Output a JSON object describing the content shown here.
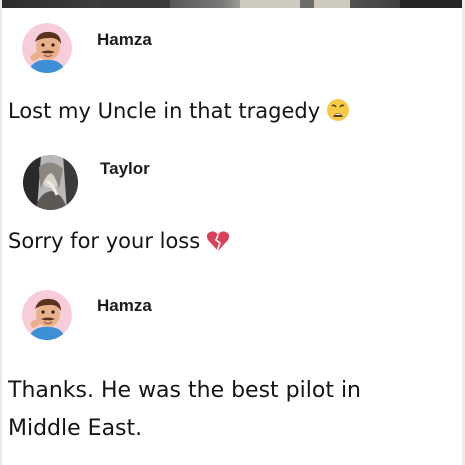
{
  "thread": {
    "comments": [
      {
        "author": "Hamza",
        "text": "Lost my Uncle in that tragedy",
        "emoji": "weary-face-emoji",
        "avatar": "hamza-cartoon-avatar"
      },
      {
        "author": "Taylor",
        "text": "Sorry for your loss",
        "emoji": "broken-heart-emoji",
        "avatar": "taylor-photo-avatar"
      },
      {
        "author": "Hamza",
        "text_line1": "Thanks. He was the best pilot in",
        "text_line2": "Middle East.",
        "avatar": "hamza-cartoon-avatar"
      }
    ]
  },
  "colors": {
    "avatar_bg_pink": "#f6cdd9",
    "avatar_bg_gray": "#b9b9b9",
    "emoji_yellow": "#f7c948",
    "heart_red": "#d9415a",
    "text": "#141414"
  }
}
